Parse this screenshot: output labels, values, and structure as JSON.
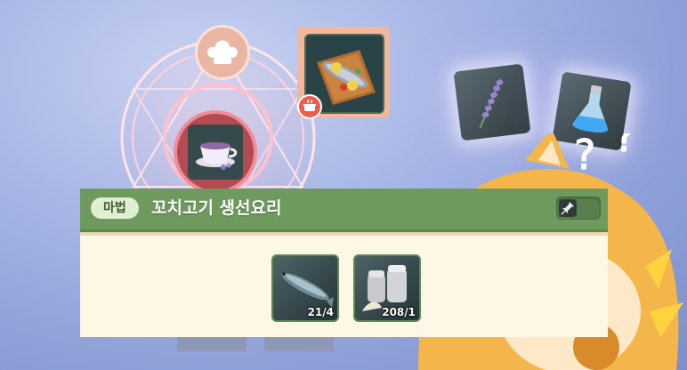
{
  "recipe": {
    "category": "마법",
    "title": "꼬치고기 생선요리"
  },
  "ingredients": [
    {
      "name": "fish",
      "count": "21/4"
    },
    {
      "name": "salt-shakers",
      "count": "208/1"
    }
  ],
  "icons": {
    "chef": "chef-hat-icon",
    "tea": "tea-cup-icon",
    "dish": "grilled-fish-icon",
    "pin": "pin-icon",
    "lavender": "lavender-icon",
    "potion": "potion-icon"
  },
  "colors": {
    "header": "#6f9a5e",
    "body": "#fdf7e6",
    "badge": "#dff0d0",
    "dish_frame": "#f2b79c"
  }
}
